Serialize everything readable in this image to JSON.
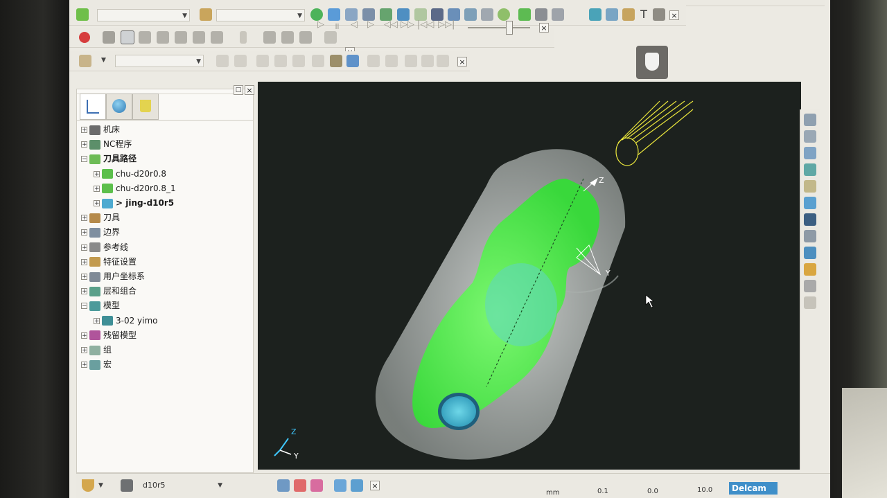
{
  "toolbar2": {
    "fields": [
      "",
      ""
    ]
  },
  "toolbar3": {
    "field": ""
  },
  "explorer": {
    "items": [
      {
        "label": "机床",
        "icon": "machine-icon",
        "level": 0
      },
      {
        "label": "NC程序",
        "icon": "nc-program-icon",
        "level": 0
      },
      {
        "label": "刀具路径",
        "icon": "toolpath-icon",
        "level": 0,
        "bold": true
      },
      {
        "label": "chu-d20r0.8",
        "icon": "toolpath-layer-icon",
        "level": 1
      },
      {
        "label": "chu-d20r0.8_1",
        "icon": "toolpath-layer-icon",
        "level": 1
      },
      {
        "label": "> jing-d10r5",
        "icon": "active-toolpath-icon",
        "level": 1,
        "bold": true
      },
      {
        "label": "刀具",
        "icon": "tool-icon",
        "level": 0
      },
      {
        "label": "边界",
        "icon": "boundary-icon",
        "level": 0
      },
      {
        "label": "参考线",
        "icon": "pattern-icon",
        "level": 0
      },
      {
        "label": "特征设置",
        "icon": "feature-icon",
        "level": 0
      },
      {
        "label": "用户坐标系",
        "icon": "workplane-icon",
        "level": 0
      },
      {
        "label": "层和组合",
        "icon": "layers-icon",
        "level": 0
      },
      {
        "label": "模型",
        "icon": "model-icon",
        "level": 0
      },
      {
        "label": "3-02 yimo",
        "icon": "model-file-icon",
        "level": 1
      },
      {
        "label": "残留模型",
        "icon": "stock-model-icon",
        "level": 0
      },
      {
        "label": "组",
        "icon": "group-icon",
        "level": 0
      },
      {
        "label": "宏",
        "icon": "macro-icon",
        "level": 0
      }
    ]
  },
  "viewport": {
    "axis_z": "Z",
    "axis_y": "Y",
    "triad_z": "Z",
    "triad_y": "Y"
  },
  "status": {
    "tool": "d10r5",
    "units": "mm",
    "tolerance": "0.1",
    "thickness": "0.0",
    "stepover": "10.0",
    "brand": "Delcam"
  },
  "colors": {
    "model": "#4cf04a",
    "stock": "#d8dbd9",
    "viewport_bg": "#1c211e",
    "tool_wire": "#e8e43c"
  }
}
